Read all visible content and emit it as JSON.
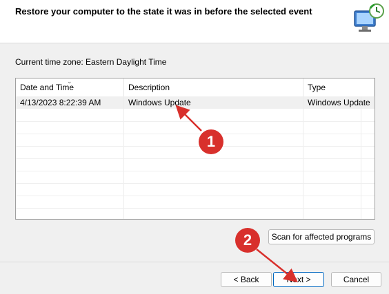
{
  "header": {
    "title": "Restore your computer to the state it was in before the selected event",
    "icon": "system-restore-icon"
  },
  "timezone_label": "Current time zone: Eastern Daylight Time",
  "table": {
    "columns": [
      "Date and Time",
      "Description",
      "Type"
    ],
    "sorted_column": "Date and Time",
    "rows": [
      {
        "date": "4/13/2023 8:22:39 AM",
        "description": "Windows Update",
        "type": "Windows Update",
        "selected": true
      }
    ]
  },
  "buttons": {
    "scan": "Scan for affected programs",
    "back": "< Back",
    "next": "Next >",
    "cancel": "Cancel"
  },
  "annotations": {
    "badge1": "1",
    "badge2": "2",
    "color": "#d8302c"
  }
}
